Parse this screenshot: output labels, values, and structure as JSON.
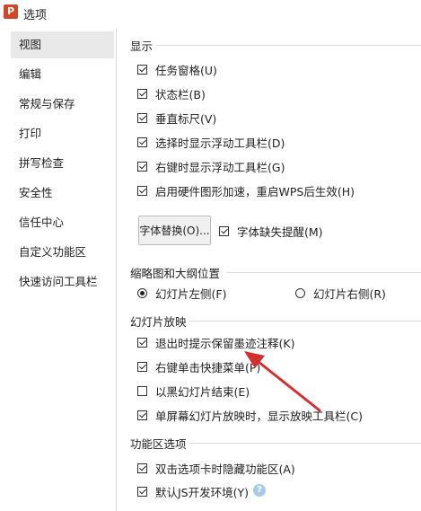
{
  "window": {
    "title": "选项",
    "app_icon_letter": "P"
  },
  "sidebar": {
    "items": [
      {
        "label": "视图"
      },
      {
        "label": "编辑"
      },
      {
        "label": "常规与保存"
      },
      {
        "label": "打印"
      },
      {
        "label": "拼写检查"
      },
      {
        "label": "安全性"
      },
      {
        "label": "信任中心"
      },
      {
        "label": "自定义功能区"
      },
      {
        "label": "快速访问工具栏"
      }
    ]
  },
  "display": {
    "title": "显示",
    "options": [
      {
        "label": "任务窗格(U)",
        "checked": true
      },
      {
        "label": "状态栏(B)",
        "checked": true
      },
      {
        "label": "垂直标尺(V)",
        "checked": true
      },
      {
        "label": "选择时显示浮动工具栏(D)",
        "checked": true
      },
      {
        "label": "右键时显示浮动工具栏(G)",
        "checked": true
      },
      {
        "label": "启用硬件图形加速，重启WPS后生效(H)",
        "checked": true
      }
    ],
    "font_replace_button": "字体替换(O)...",
    "font_missing_label": "字体缺失提醒(M)",
    "font_missing_checked": true
  },
  "thumbnail": {
    "title": "缩略图和大纲位置",
    "left_label": "幻灯片左侧(F)",
    "right_label": "幻灯片右侧(R)",
    "selected": "left"
  },
  "slideshow": {
    "title": "幻灯片放映",
    "options": [
      {
        "label": "退出时提示保留墨迹注释(K)",
        "checked": true
      },
      {
        "label": "右键单击快捷菜单(P)",
        "checked": true
      },
      {
        "label": "以黑幻灯片结束(E)",
        "checked": false
      },
      {
        "label": "单屏幕幻灯片放映时，显示放映工具栏(C)",
        "checked": true
      }
    ]
  },
  "ribbon": {
    "title": "功能区选项",
    "options": [
      {
        "label": "双击选项卡时隐藏功能区(A)",
        "checked": true
      },
      {
        "label": "默认JS开发环境(Y)",
        "checked": true
      }
    ],
    "help_glyph": "?"
  },
  "annotation": {
    "arrow_color": "#d32f2f"
  }
}
